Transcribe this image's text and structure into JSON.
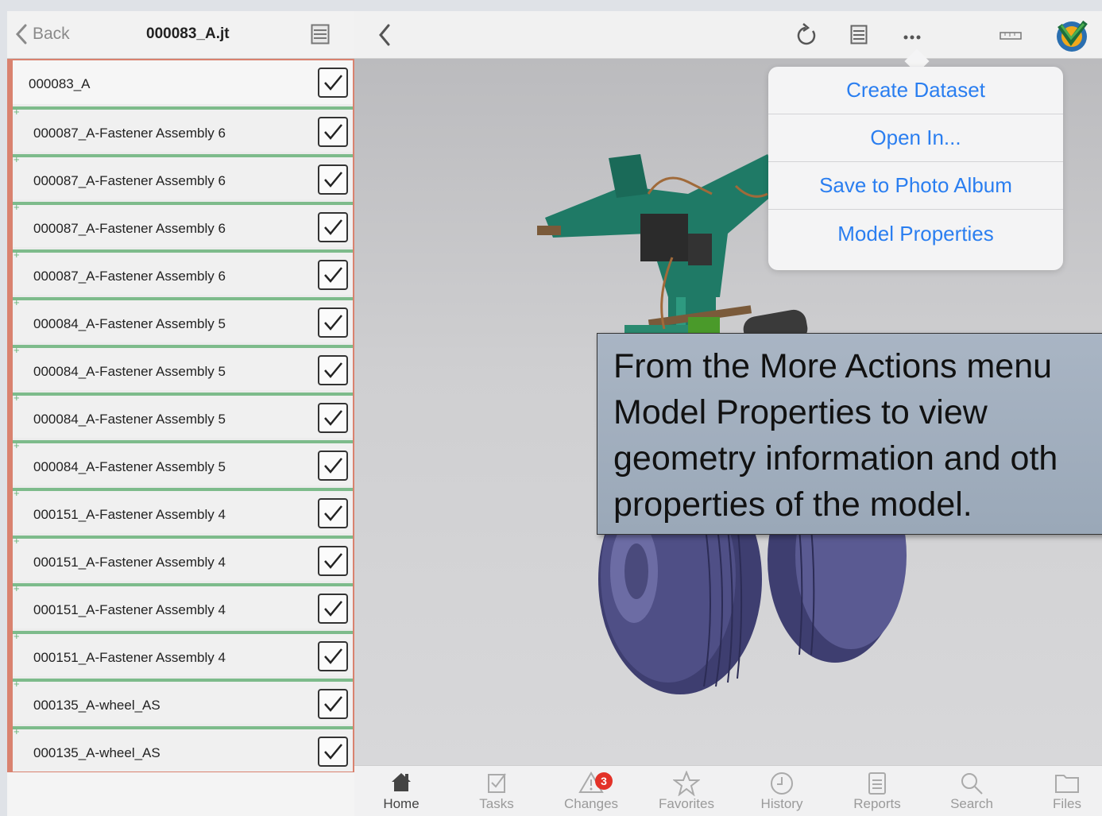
{
  "left_panel": {
    "back_label": "Back",
    "title": "000083_A.jt",
    "items": [
      {
        "label": "000083_A",
        "checked": true,
        "type": "root"
      },
      {
        "label": "000087_A-Fastener Assembly 6",
        "checked": true,
        "type": "child"
      },
      {
        "label": "000087_A-Fastener Assembly 6",
        "checked": true,
        "type": "child"
      },
      {
        "label": "000087_A-Fastener Assembly 6",
        "checked": true,
        "type": "child"
      },
      {
        "label": "000087_A-Fastener Assembly 6",
        "checked": true,
        "type": "child"
      },
      {
        "label": "000084_A-Fastener Assembly 5",
        "checked": true,
        "type": "child"
      },
      {
        "label": "000084_A-Fastener Assembly 5",
        "checked": true,
        "type": "child"
      },
      {
        "label": "000084_A-Fastener Assembly 5",
        "checked": true,
        "type": "child"
      },
      {
        "label": "000084_A-Fastener Assembly 5",
        "checked": true,
        "type": "child"
      },
      {
        "label": "000151_A-Fastener Assembly 4",
        "checked": true,
        "type": "child"
      },
      {
        "label": "000151_A-Fastener Assembly 4",
        "checked": true,
        "type": "child"
      },
      {
        "label": "000151_A-Fastener Assembly 4",
        "checked": true,
        "type": "child"
      },
      {
        "label": "000151_A-Fastener Assembly 4",
        "checked": true,
        "type": "child"
      },
      {
        "label": "000135_A-wheel_AS",
        "checked": true,
        "type": "child"
      },
      {
        "label": "000135_A-wheel_AS",
        "checked": true,
        "type": "child"
      }
    ]
  },
  "toolbar": {
    "icons": [
      "back-chevron-icon",
      "refresh-icon",
      "panel-icon",
      "more-icon",
      "ruler-icon",
      "app-logo-icon"
    ]
  },
  "more_menu": {
    "items": [
      "Create Dataset",
      "Open In...",
      "Save to Photo Album",
      "Model Properties"
    ]
  },
  "callout": {
    "lines": [
      "From the More Actions menu",
      "Model Properties to view",
      "geometry information and oth",
      "properties of the model."
    ]
  },
  "tabbar": {
    "tabs": [
      {
        "label": "Home",
        "icon": "home-icon",
        "active": true
      },
      {
        "label": "Tasks",
        "icon": "tasks-icon"
      },
      {
        "label": "Changes",
        "icon": "changes-icon",
        "badge": "3"
      },
      {
        "label": "Favorites",
        "icon": "star-icon"
      },
      {
        "label": "History",
        "icon": "clock-icon"
      },
      {
        "label": "Reports",
        "icon": "reports-icon"
      },
      {
        "label": "Search",
        "icon": "search-icon"
      },
      {
        "label": "Files",
        "icon": "folder-icon"
      }
    ]
  },
  "colors": {
    "accent_blue": "#2a7ef0",
    "tree_border": "#d9826f",
    "child_line": "#7dbb8b",
    "model_green": "#1f7a66",
    "wheel_purple": "#4a4a78"
  }
}
